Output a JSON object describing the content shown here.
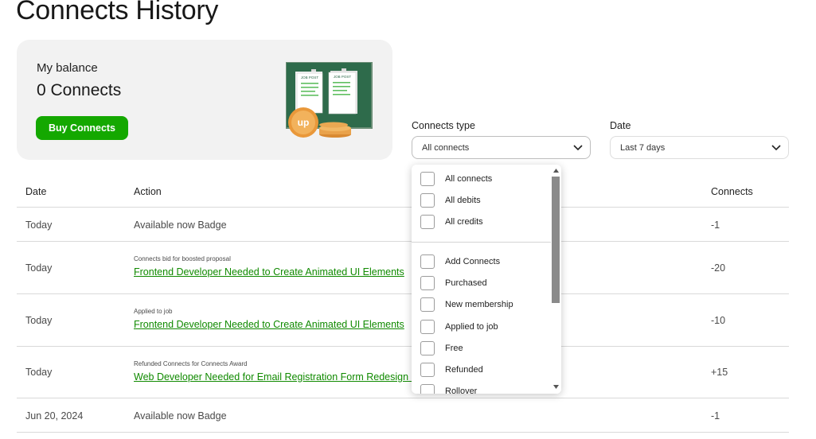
{
  "page": {
    "title": "Connects History"
  },
  "balance": {
    "label": "My balance",
    "value": "0 Connects",
    "buy_label": "Buy Connects",
    "illustration": {
      "post1": "JOB POST",
      "post2": "JOB POST",
      "coin": "up"
    }
  },
  "filters": {
    "type_label": "Connects type",
    "type_value": "All connects",
    "date_label": "Date",
    "date_value": "Last 7 days"
  },
  "table": {
    "headers": {
      "date": "Date",
      "action": "Action",
      "connects": "Connects"
    },
    "rows": [
      {
        "date": "Today",
        "action": "Available now Badge",
        "note": "",
        "link": "",
        "connects": "-1"
      },
      {
        "date": "Today",
        "action": "",
        "note": "Connects bid for boosted proposal",
        "link": "Frontend Developer Needed to Create Animated UI Elements",
        "connects": "-20"
      },
      {
        "date": "Today",
        "action": "",
        "note": "Applied to job",
        "link": "Frontend Developer Needed to Create Animated UI Elements",
        "connects": "-10"
      },
      {
        "date": "Today",
        "action": "",
        "note": "Refunded Connects for Connects Award",
        "link": "Web Developer Needed for Email Registration Form Redesign ar",
        "connects": "+15"
      },
      {
        "date": "Jun 20, 2024",
        "action": "Available now Badge",
        "note": "",
        "link": "",
        "connects": "-1"
      }
    ]
  },
  "dropdown": {
    "options": [
      "All connects",
      "All debits",
      "All credits",
      "Add Connects",
      "Purchased",
      "New membership",
      "Applied to job",
      "Free",
      "Refunded",
      "Rollover"
    ],
    "icons": {
      "scroll_up": "scroll-up-arrow-icon",
      "scroll_down": "scroll-down-arrow-icon",
      "chevron": "chevron-down-icon"
    }
  },
  "colors": {
    "brand_green": "#14a800",
    "link_green": "#108a00",
    "card_bg": "#f2f2f2"
  }
}
